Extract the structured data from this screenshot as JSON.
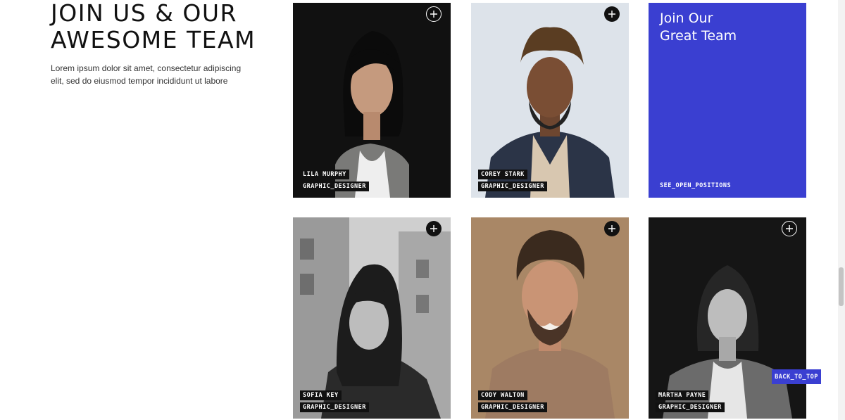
{
  "intro": {
    "heading_line1": "JOIN US & OUR",
    "heading_line2": "AWESOME TEAM",
    "description": "Lorem ipsum dolor sit amet, consectetur adipiscing elit, sed do eiusmod tempor incididunt ut labore"
  },
  "team": [
    {
      "name": "LILA MURPHY",
      "role": "GRAPHIC_DESIGNER",
      "plus_icon": "plus-icon"
    },
    {
      "name": "COREY STARK",
      "role": "GRAPHIC_DESIGNER",
      "plus_icon": "plus-icon"
    },
    {
      "name": "SOFIA KEY",
      "role": "GRAPHIC_DESIGNER",
      "plus_icon": "plus-icon"
    },
    {
      "name": "CODY WALTON",
      "role": "GRAPHIC_DESIGNER",
      "plus_icon": "plus-icon"
    },
    {
      "name": "MARTHA PAYNE",
      "role": "GRAPHIC_DESIGNER",
      "plus_icon": "plus-icon"
    }
  ],
  "cta": {
    "title_line1": "Join Our",
    "title_line2": "Great Team",
    "link": "SEE_OPEN_POSITIONS",
    "color": "#3a3fd1"
  },
  "back_to_top": "BACK_TO_TOP"
}
